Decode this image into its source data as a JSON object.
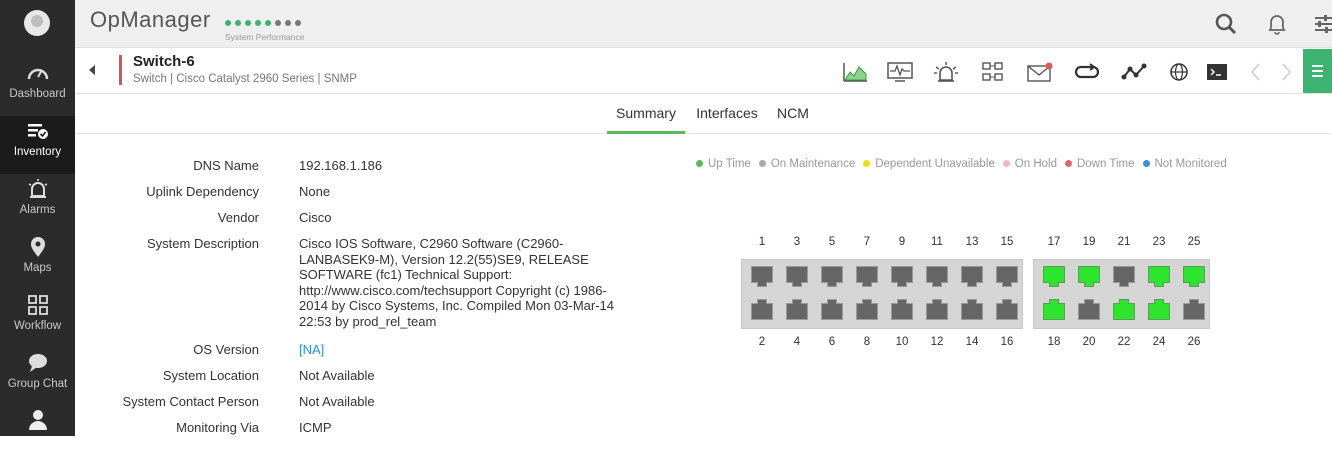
{
  "sidebar": {
    "items": [
      {
        "label": "Dashboard",
        "icon": "gauge-icon"
      },
      {
        "label": "Inventory",
        "icon": "inventory-icon"
      },
      {
        "label": "Alarms",
        "icon": "alarm-icon"
      },
      {
        "label": "Maps",
        "icon": "map-pin-icon"
      },
      {
        "label": "Workflow",
        "icon": "workflow-icon"
      },
      {
        "label": "Group Chat",
        "icon": "chat-icon"
      },
      {
        "label": "",
        "icon": "user-icon"
      }
    ],
    "active_index": 1
  },
  "topbar": {
    "brand": "OpManager",
    "perf_caption": "System Performance",
    "perf_dots": [
      "#3cb371",
      "#3cb371",
      "#3cb371",
      "#3cb371",
      "#3cb371",
      "#777777",
      "#777777",
      "#777777"
    ]
  },
  "device": {
    "name": "Switch-6",
    "subtitle": "Switch | Cisco Catalyst 2960 Series  | SNMP"
  },
  "tabs": [
    "Summary",
    "Interfaces",
    "NCM"
  ],
  "active_tab": 0,
  "details": [
    {
      "label": "DNS Name",
      "value": "192.168.1.186"
    },
    {
      "label": "Uplink Dependency",
      "value": "None"
    },
    {
      "label": "Vendor",
      "value": "Cisco"
    },
    {
      "label": "System Description",
      "lines": [
        "Cisco IOS Software, C2960 Software (C2960-",
        "LANBASEK9-M), Version 12.2(55)SE9, RELEASE",
        "SOFTWARE (fc1) Technical Support:",
        "http://www.cisco.com/techsupport Copyright (c) 1986-",
        "2014 by Cisco Systems, Inc. Compiled Mon 03-Mar-14",
        "22:53 by prod_rel_team"
      ]
    },
    {
      "label": "OS Version",
      "value": "[NA]"
    },
    {
      "label": "System Location",
      "value": "Not Available"
    },
    {
      "label": "System Contact Person",
      "value": "Not Available"
    },
    {
      "label": "Monitoring Via",
      "value": "ICMP"
    }
  ],
  "legend": [
    {
      "label": "Up Time",
      "color": "#5cb85c"
    },
    {
      "label": "On Maintenance",
      "color": "#aaaaaa"
    },
    {
      "label": "Dependent Unavailable",
      "color": "#f0e000"
    },
    {
      "label": "On Hold",
      "color": "#f4b6c2"
    },
    {
      "label": "Down Time",
      "color": "#e06666"
    },
    {
      "label": "Not Monitored",
      "color": "#3a8fd9"
    }
  ],
  "ports": {
    "top_numbers": [
      "1",
      "3",
      "5",
      "7",
      "9",
      "11",
      "13",
      "15",
      "17",
      "19",
      "21",
      "23",
      "25"
    ],
    "bottom_numbers": [
      "2",
      "4",
      "6",
      "8",
      "10",
      "12",
      "14",
      "16",
      "18",
      "20",
      "22",
      "24",
      "26"
    ],
    "up_ports": [
      "17",
      "19",
      "23",
      "25",
      "18",
      "22",
      "24"
    ]
  }
}
